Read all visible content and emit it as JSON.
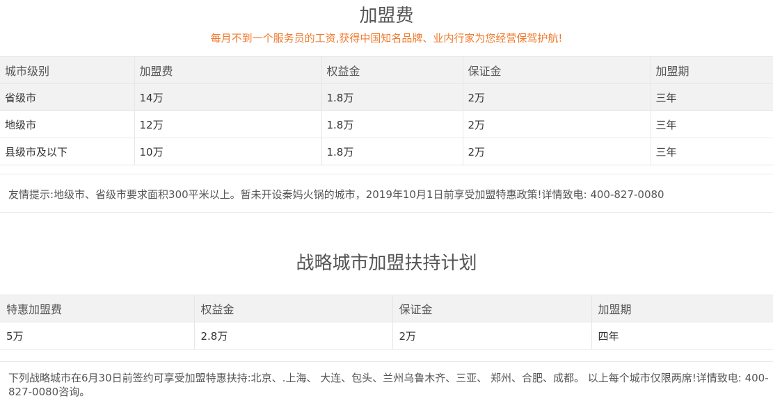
{
  "section1": {
    "title": "加盟费",
    "subtitle": "每月不到一个服务员的工资,获得中国知名品牌、业内行家为您经营保驾护航!",
    "headers": [
      "城市级别",
      "加盟费",
      "权益金",
      "保证金",
      "加盟期"
    ],
    "rows": [
      [
        "省级市",
        "14万",
        "1.8万",
        "2万",
        "三年"
      ],
      [
        "地级市",
        "12万",
        "1.8万",
        "2万",
        "三年"
      ],
      [
        "县级市及以下",
        "10万",
        "1.8万",
        "2万",
        "三年"
      ]
    ],
    "note": "友情提示:地级市、省级市要求面积300平米以上。暂未开设秦妈火锅的城市，2019年10月1日前享受加盟特惠政策!详情致电: 400-827-0080"
  },
  "section2": {
    "title": "战略城市加盟扶持计划",
    "headers": [
      "特惠加盟费",
      "权益金",
      "保证金",
      "加盟期"
    ],
    "rows": [
      [
        "5万",
        "2.8万",
        "2万",
        "四年"
      ]
    ],
    "note": "下列战略城市在6月30日前签约可享受加盟特惠扶持:北京、.上海、 大连、包头、兰州乌鲁木齐、三亚、 郑州、合肥、成都。 以上每个城市仅限两席!详情致电: 400-827-0080咨询。"
  }
}
